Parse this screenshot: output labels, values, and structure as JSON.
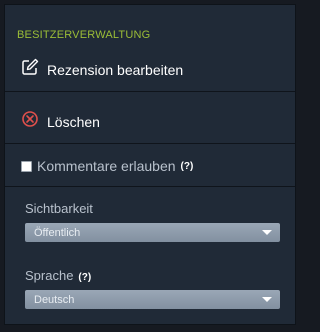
{
  "owner_panel": {
    "section_title": "BESITZERVERWALTUNG",
    "edit_review": {
      "label": "Rezension bearbeiten",
      "icon": "edit-icon"
    },
    "delete": {
      "label": "Löschen",
      "icon": "delete-icon",
      "icon_color": "#e0504c"
    },
    "allow_comments": {
      "label": "Kommentare erlauben",
      "checked": false,
      "help": "(?)"
    },
    "visibility": {
      "label": "Sichtbarkeit",
      "value": "Öffentlich"
    },
    "language": {
      "label": "Sprache",
      "help": "(?)",
      "value": "Deutsch"
    },
    "colors": {
      "accent": "#9bbd37",
      "panel_bg": "#202a37",
      "page_bg": "#161a21"
    }
  }
}
